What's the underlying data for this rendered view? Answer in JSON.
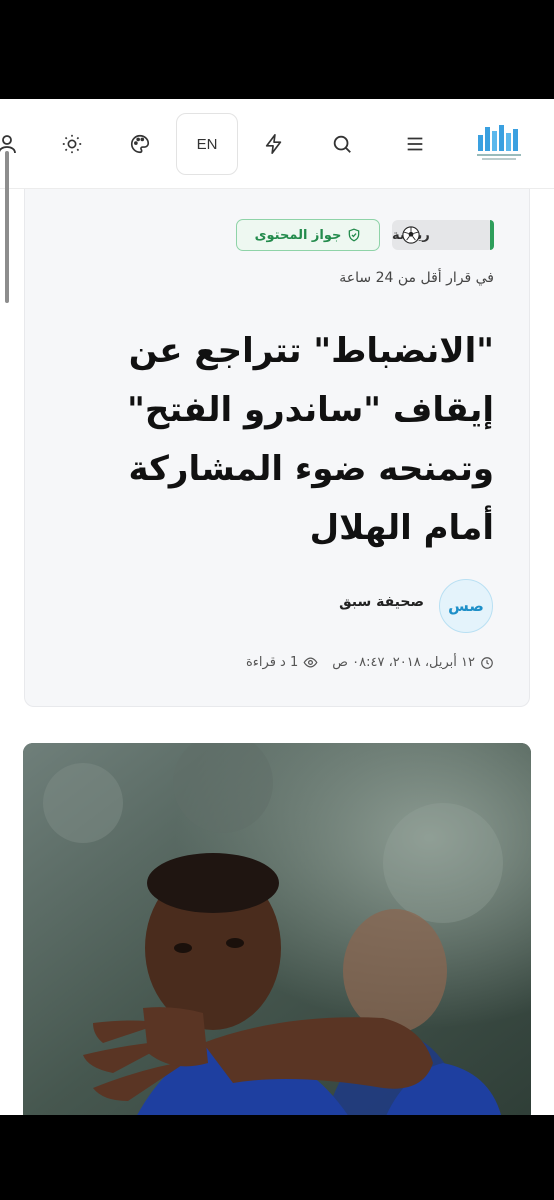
{
  "header": {
    "language_label": "EN",
    "icons": [
      "account-icon",
      "theme-icon",
      "palette-icon",
      "lightning-icon",
      "search-icon",
      "menu-icon"
    ]
  },
  "article": {
    "category": "رياضة",
    "content_pass": "جواز المحتوى",
    "read_time": "في قرار أقل من 24 ساعة",
    "title": "\"الانضباط\" تتراجع عن إيقاف \"ساندرو الفتح\" وتمنحه ضوء المشاركة أمام الهلال",
    "author_initials": "صس",
    "author_name": "صحيفة سبق",
    "date": "١٢ أبريل، ٢٠١٨، ٠٨:٤٧ ص",
    "reading": "1 د قراءة"
  },
  "colors": {
    "accent_green": "#2e9e5b",
    "pass_green": "#238b4c",
    "author_blue": "#1d8fc8",
    "logo_blue": "#3aa0e0"
  }
}
